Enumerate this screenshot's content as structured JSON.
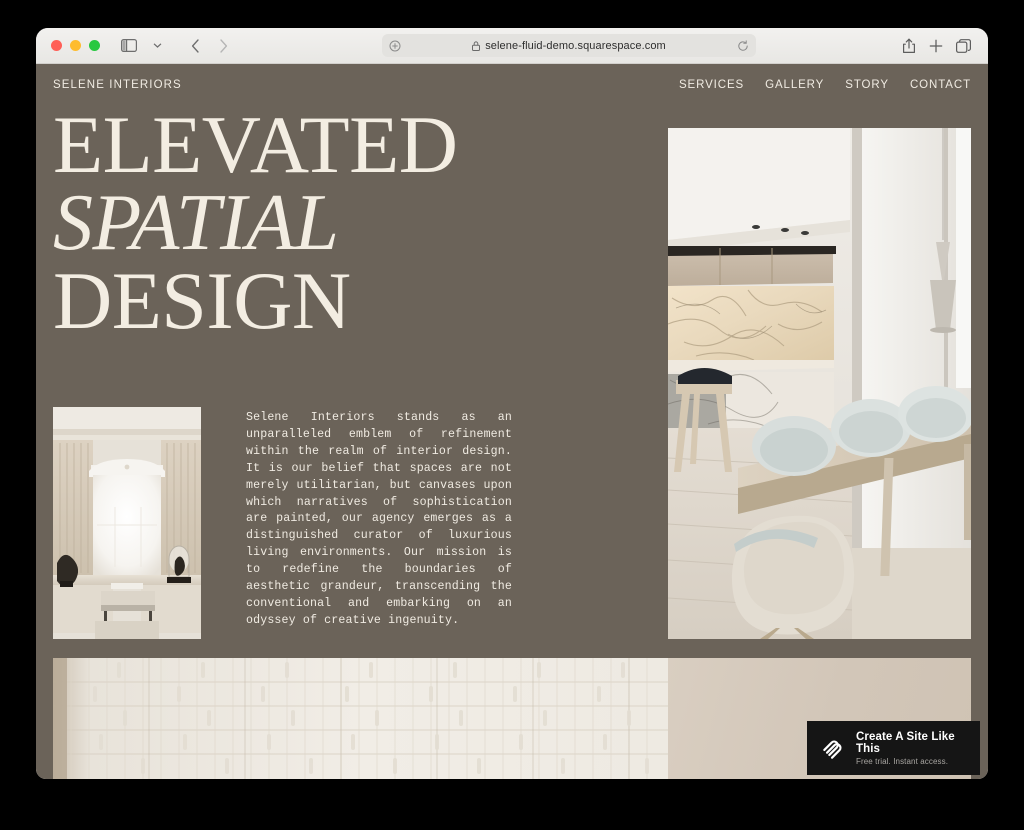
{
  "browser": {
    "traffic_lights": [
      "close",
      "minimize",
      "zoom"
    ],
    "sidebar_toggle": "sidebar-icon",
    "tab_overview": "chevron-down-icon",
    "back": "back-chevron-icon",
    "forward": "forward-chevron-icon",
    "url": "selene-fluid-demo.squarespace.com",
    "url_lock": "lock-icon",
    "url_reader": "reader-icon",
    "url_reload": "reload-icon",
    "share": "share-icon",
    "new_tab": "plus-icon",
    "tabs": "tabs-icon"
  },
  "site": {
    "brand": "SELENE INTERIORS",
    "nav": [
      {
        "label": "SERVICES"
      },
      {
        "label": "GALLERY"
      },
      {
        "label": "STORY"
      },
      {
        "label": "CONTACT"
      }
    ],
    "hero": {
      "line1": "ELEVATED",
      "line2": "SPATIAL",
      "line3": "DESIGN"
    },
    "about": "Selene Interiors stands as an unparalleled emblem of refinement within the realm of interior design. It is our belief that spaces are not merely utilitarian, but canvases upon which narratives of sophistication are painted, our agency emerges as a distinguished curator of luxurious living environments. Our mission is to redefine the boundaries of aesthetic grandeur, transcending the conventional and embarking on an odyssey of creative ingenuity.",
    "images": {
      "hero_photo": "modern-kitchen-dining-interior-photo",
      "about_photo": "bright-window-room-interior-photo",
      "tile_panel": "vertical-tile-texture-photo",
      "beige_panel": "beige-wall-photo"
    }
  },
  "promo": {
    "logo": "squarespace-logo-icon",
    "title": "Create A Site Like This",
    "subtitle": "Free trial. Instant access."
  },
  "colors": {
    "page_background": "#6b6359",
    "text_cream": "#f0ebe2",
    "promo_background": "#151515"
  }
}
